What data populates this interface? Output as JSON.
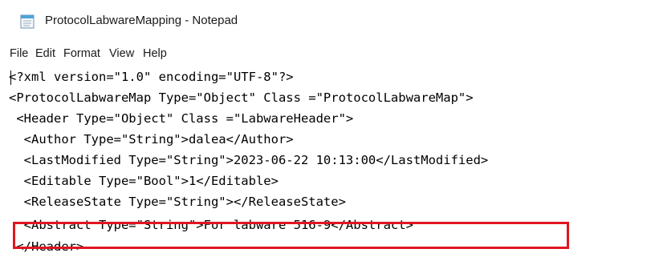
{
  "window": {
    "title": "ProtocolLabwareMapping - Notepad",
    "icon": "notepad-icon"
  },
  "menu": {
    "items": [
      "File",
      "Edit",
      "Format",
      "View",
      "Help"
    ]
  },
  "editor": {
    "lines": [
      "<?xml version=\"1.0\" encoding=\"UTF-8\"?>",
      "<ProtocolLabwareMap Type=\"Object\" Class =\"ProtocolLabwareMap\">",
      " <Header Type=\"Object\" Class =\"LabwareHeader\">",
      "  <Author Type=\"String\">dalea</Author>",
      "  <LastModified Type=\"String\">2023-06-22 10:13:00</LastModified>",
      "  <Editable Type=\"Bool\">1</Editable>",
      "  <ReleaseState Type=\"String\"></ReleaseState>",
      "  <Abstract Type=\"String\">For labware 516-9</Abstract>",
      " </Header>"
    ]
  },
  "annotation": {
    "highlight_color": "#e0151f",
    "highlighted_line": 8
  }
}
